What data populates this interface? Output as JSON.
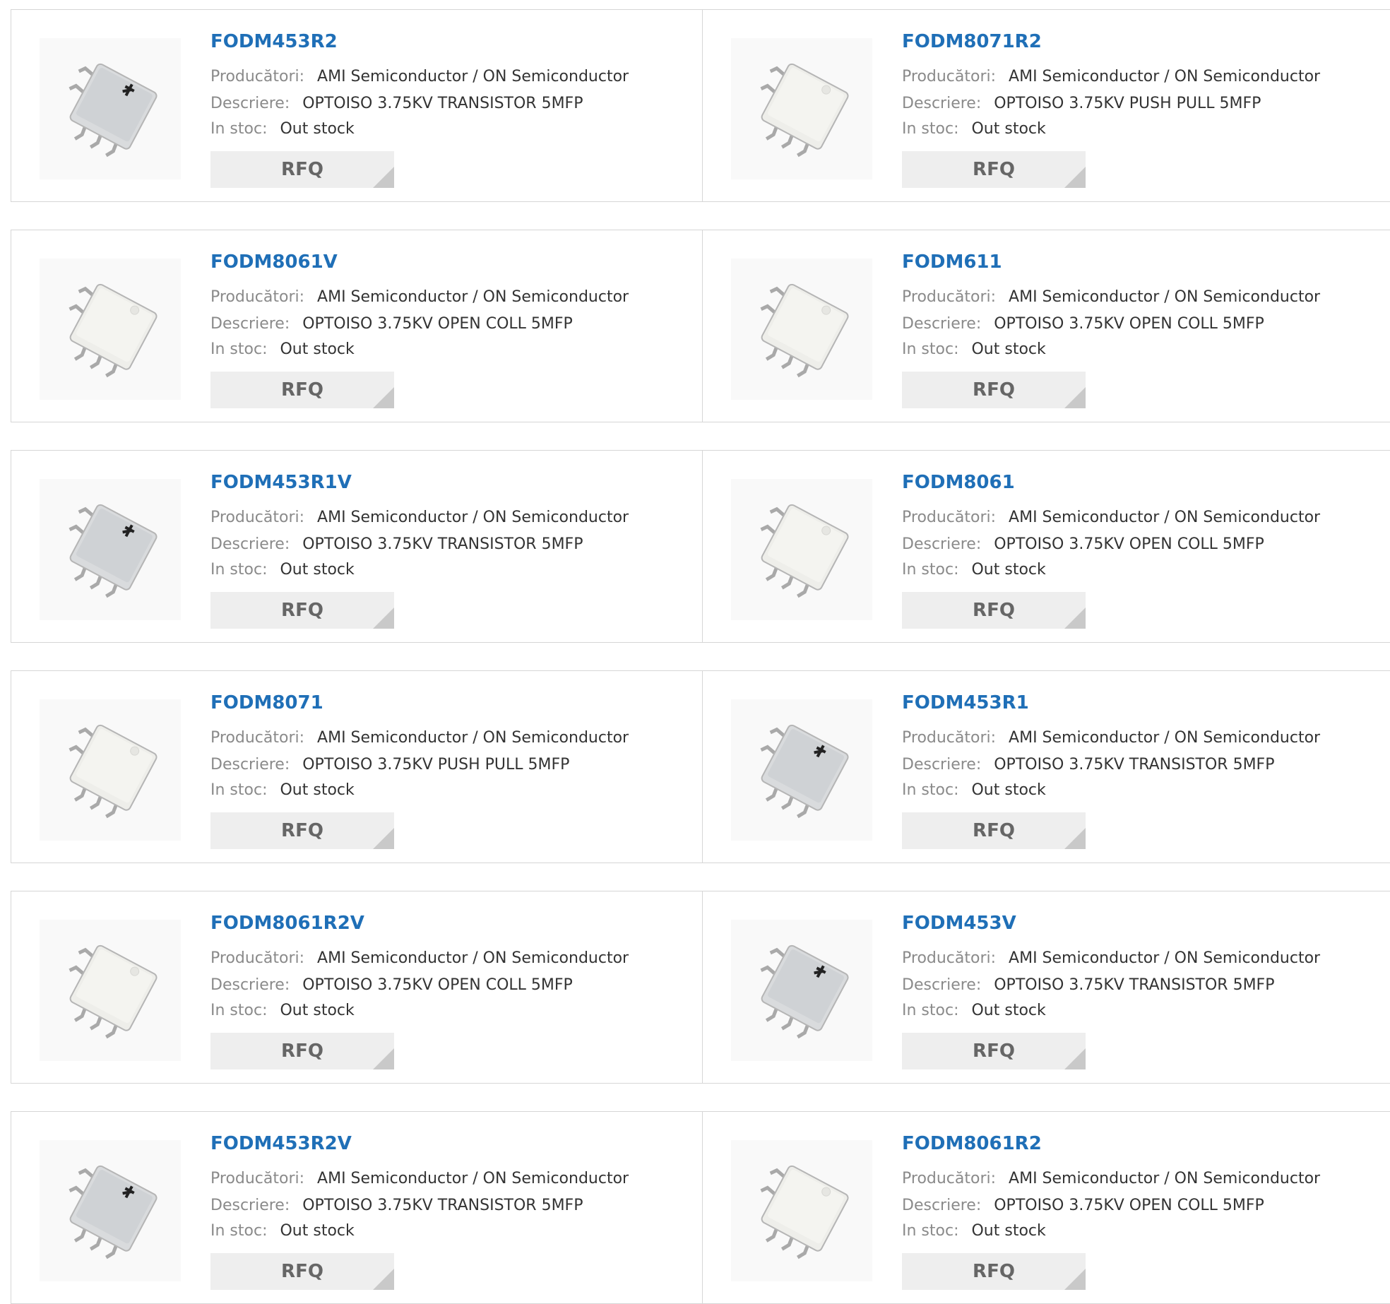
{
  "labels": {
    "manufacturer": "Producători:",
    "description": "Descriere:",
    "stock": "In stoc:",
    "rfq": "RFQ"
  },
  "products": [
    {
      "name": "FODM453R2",
      "manufacturer": "AMI Semiconductor / ON Semiconductor",
      "description": "OPTOISO 3.75KV TRANSISTOR 5MFP",
      "stock": "Out stock",
      "icon": "chip-gray-logo-icon"
    },
    {
      "name": "FODM8071R2",
      "manufacturer": "AMI Semiconductor / ON Semiconductor",
      "description": "OPTOISO 3.75KV PUSH PULL 5MFP",
      "stock": "Out stock",
      "icon": "chip-white-icon"
    },
    {
      "name": "FODM8061V",
      "manufacturer": "AMI Semiconductor / ON Semiconductor",
      "description": "OPTOISO 3.75KV OPEN COLL 5MFP",
      "stock": "Out stock",
      "icon": "chip-white-icon"
    },
    {
      "name": "FODM611",
      "manufacturer": "AMI Semiconductor / ON Semiconductor",
      "description": "OPTOISO 3.75KV OPEN COLL 5MFP",
      "stock": "Out stock",
      "icon": "chip-white-icon"
    },
    {
      "name": "FODM453R1V",
      "manufacturer": "AMI Semiconductor / ON Semiconductor",
      "description": "OPTOISO 3.75KV TRANSISTOR 5MFP",
      "stock": "Out stock",
      "icon": "chip-gray-logo-icon"
    },
    {
      "name": "FODM8061",
      "manufacturer": "AMI Semiconductor / ON Semiconductor",
      "description": "OPTOISO 3.75KV OPEN COLL 5MFP",
      "stock": "Out stock",
      "icon": "chip-white-icon"
    },
    {
      "name": "FODM8071",
      "manufacturer": "AMI Semiconductor / ON Semiconductor",
      "description": "OPTOISO 3.75KV PUSH PULL 5MFP",
      "stock": "Out stock",
      "icon": "chip-white-icon"
    },
    {
      "name": "FODM453R1",
      "manufacturer": "AMI Semiconductor / ON Semiconductor",
      "description": "OPTOISO 3.75KV TRANSISTOR 5MFP",
      "stock": "Out stock",
      "icon": "chip-gray-logo-icon"
    },
    {
      "name": "FODM8061R2V",
      "manufacturer": "AMI Semiconductor / ON Semiconductor",
      "description": "OPTOISO 3.75KV OPEN COLL 5MFP",
      "stock": "Out stock",
      "icon": "chip-white-icon"
    },
    {
      "name": "FODM453V",
      "manufacturer": "AMI Semiconductor / ON Semiconductor",
      "description": "OPTOISO 3.75KV TRANSISTOR 5MFP",
      "stock": "Out stock",
      "icon": "chip-gray-logo-icon"
    },
    {
      "name": "FODM453R2V",
      "manufacturer": "AMI Semiconductor / ON Semiconductor",
      "description": "OPTOISO 3.75KV TRANSISTOR 5MFP",
      "stock": "Out stock",
      "icon": "chip-gray-logo-icon"
    },
    {
      "name": "FODM8061R2",
      "manufacturer": "AMI Semiconductor / ON Semiconductor",
      "description": "OPTOISO 3.75KV OPEN COLL 5MFP",
      "stock": "Out stock",
      "icon": "chip-white-icon"
    }
  ]
}
